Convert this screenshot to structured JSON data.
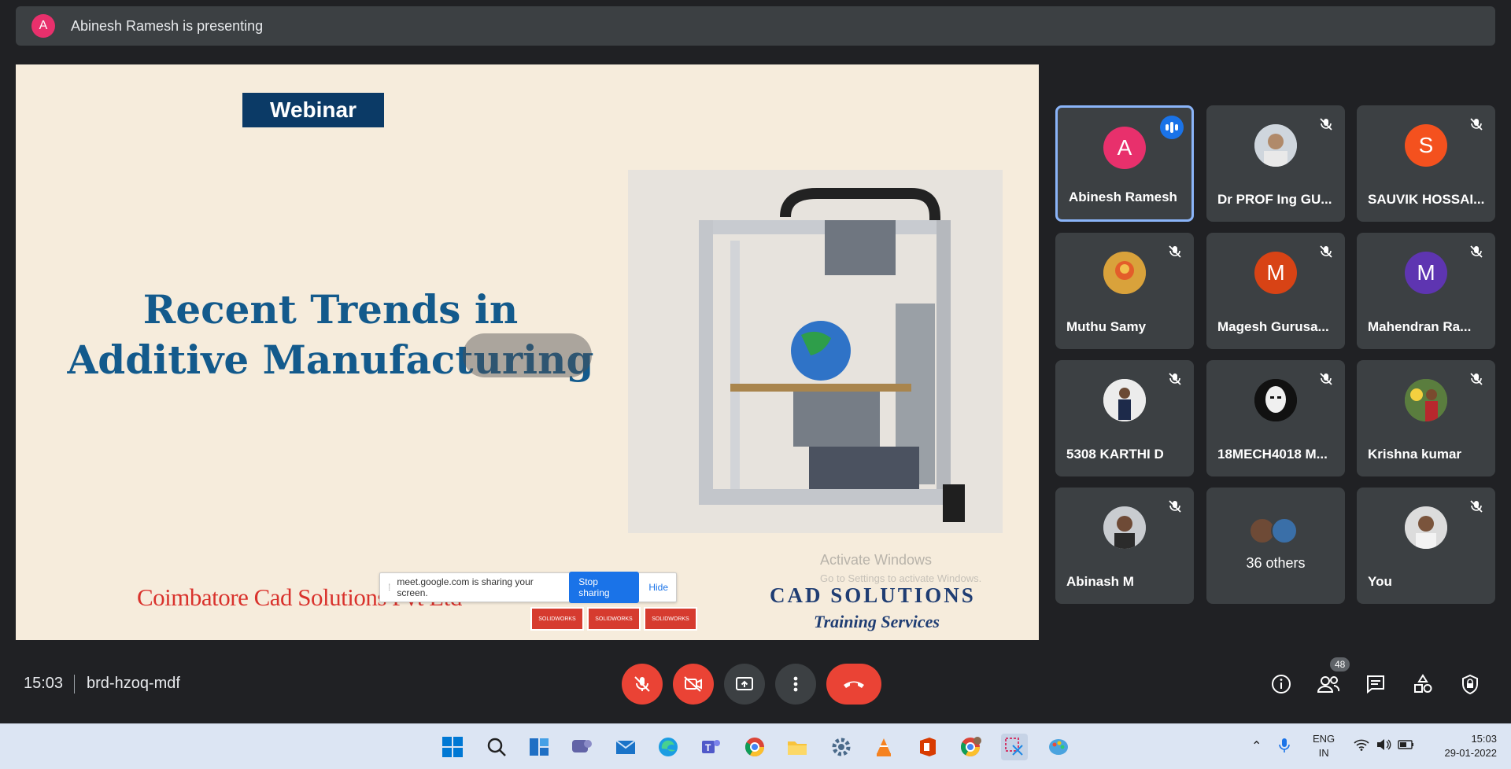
{
  "banner": {
    "avatar_letter": "A",
    "text": "Abinesh Ramesh is presenting"
  },
  "slide": {
    "badge": "Webinar",
    "title_line1": "Recent Trends in",
    "title_line2": "Additive Manufacturing",
    "company": "Coimbatore Cad Solutions Pvt Ltd",
    "cad_line1": "CAD SOLUTIONS",
    "cad_line2": "Training Services",
    "watermark_line1": "Activate Windows",
    "watermark_line2": "Go to Settings to activate Windows.",
    "share_bar": {
      "text": "meet.google.com is sharing your screen.",
      "stop_label": "Stop sharing",
      "hide_label": "Hide"
    },
    "sw_badges": [
      "SOLIDWORKS",
      "SOLIDWORKS",
      "SOLIDWORKS"
    ]
  },
  "participants": [
    {
      "name": "Abinesh Ramesh",
      "letter": "A",
      "color": "#e8306c",
      "speaking": true
    },
    {
      "name": "Dr PROF Ing GU...",
      "letter": "",
      "color": "#8d9aa8",
      "speaking": false
    },
    {
      "name": "SAUVIK HOSSAI...",
      "letter": "S",
      "color": "#f4511e",
      "speaking": false
    },
    {
      "name": "Muthu Samy",
      "letter": "",
      "color": "#c98a2e",
      "speaking": false
    },
    {
      "name": "Magesh Gurusa...",
      "letter": "M",
      "color": "#d84315",
      "speaking": false
    },
    {
      "name": "Mahendran Ra...",
      "letter": "M",
      "color": "#5e35b1",
      "speaking": false
    },
    {
      "name": "5308 KARTHI D",
      "letter": "",
      "color": "#d9d9d9",
      "speaking": false
    },
    {
      "name": "18MECH4018 M...",
      "letter": "",
      "color": "#111111",
      "speaking": false
    },
    {
      "name": "Krishna kumar",
      "letter": "",
      "color": "#6b8e4e",
      "speaking": false
    },
    {
      "name": "Abinash M",
      "letter": "",
      "color": "#7a8088",
      "speaking": false
    },
    {
      "name": "You",
      "letter": "",
      "color": "#9aa0a6",
      "speaking": false
    }
  ],
  "others": {
    "label": "36 others"
  },
  "meeting": {
    "time": "15:03",
    "code": "brd-hzoq-mdf",
    "people_count": "48"
  },
  "taskbar": {
    "lang1": "ENG",
    "lang2": "IN",
    "time": "15:03",
    "date": "29-01-2022"
  },
  "colors": {
    "end_call": "#ea4335",
    "accent": "#1a73e8",
    "tile_bg": "#3c4043"
  }
}
